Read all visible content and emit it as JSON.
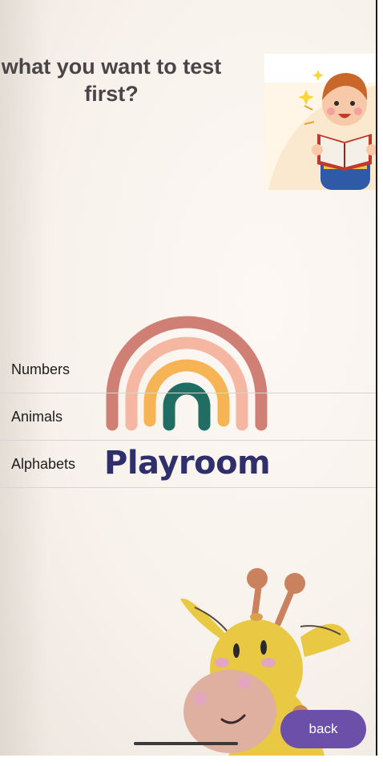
{
  "question": {
    "line1": "what you want to test",
    "line2": "first?"
  },
  "logo": {
    "text": "Playroom"
  },
  "options": [
    {
      "label": "Numbers"
    },
    {
      "label": "Animals"
    },
    {
      "label": "Alphabets"
    }
  ],
  "back_button": {
    "label": "back"
  },
  "colors": {
    "accent": "#6b4fa8",
    "title": "#4a4548",
    "logo": "#2f2f6b"
  },
  "icons": [
    "reading-kid-illustration",
    "rainbow-icon",
    "giraffe-illustration"
  ]
}
